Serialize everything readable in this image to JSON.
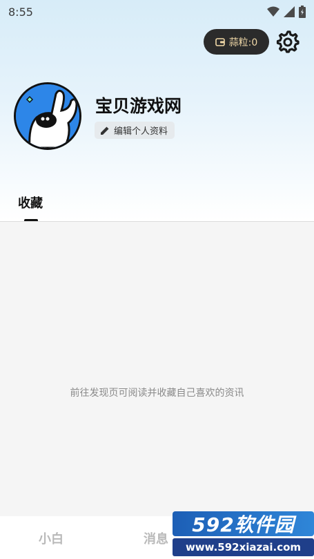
{
  "status": {
    "time": "8:55"
  },
  "header": {
    "wallet_label": "蒜粒:0",
    "username": "宝贝游戏网",
    "edit_profile_label": "编辑个人资料"
  },
  "tabs": [
    {
      "label": "收藏",
      "active": true
    }
  ],
  "content": {
    "empty_message": "前往发现页可阅读并收藏自己喜欢的资讯"
  },
  "bottom_nav": {
    "items": [
      {
        "label": "小白"
      },
      {
        "label": "消息"
      }
    ]
  },
  "watermark": {
    "brand": "592软件园",
    "url": "www.592xiazai.com"
  },
  "colors": {
    "header_gradient_top": "#d7ecf8",
    "wallet_bg": "#2b2b2b",
    "wallet_text": "#f1d9a8",
    "avatar_bg": "#2d86e8"
  },
  "icons": [
    "wifi-icon",
    "signal-icon",
    "battery-icon",
    "wallet-icon",
    "gear-icon",
    "pencil-icon"
  ]
}
